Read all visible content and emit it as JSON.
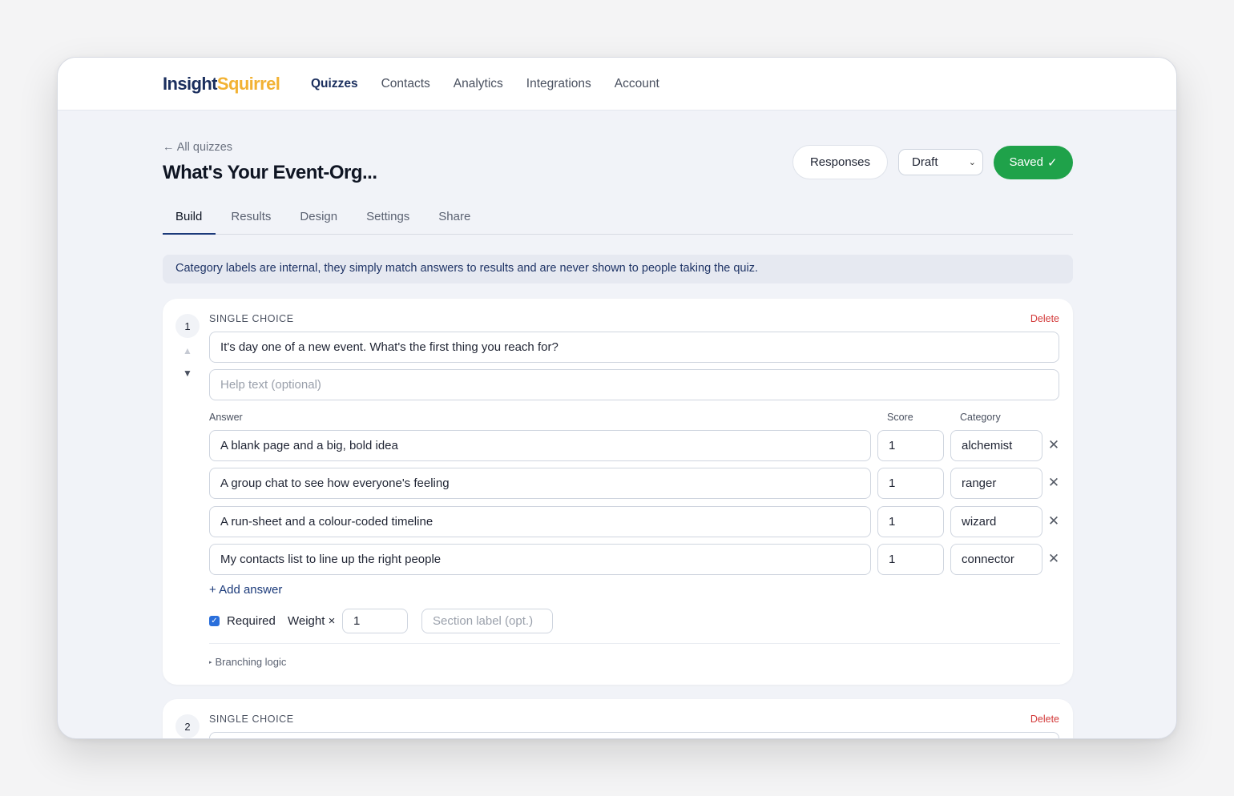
{
  "brand": {
    "part1": "Insight",
    "part2": "Squirrel"
  },
  "nav": {
    "items": [
      "Quizzes",
      "Contacts",
      "Analytics",
      "Integrations",
      "Account"
    ],
    "active": "Quizzes"
  },
  "header": {
    "back_label": "All quizzes",
    "title": "What's Your Event-Org...",
    "responses_label": "Responses",
    "status_value": "Draft",
    "saved_label": "Saved"
  },
  "tabs": [
    "Build",
    "Results",
    "Design",
    "Settings",
    "Share"
  ],
  "notice": "Category labels are internal, they simply match answers to results and are never shown to people taking the quiz.",
  "question1": {
    "number": "1",
    "type": "SINGLE CHOICE",
    "delete_label": "Delete",
    "text": "It's day one of a new event. What's the first thing you reach for?",
    "help_placeholder": "Help text (optional)",
    "headers": {
      "answer": "Answer",
      "score": "Score",
      "category": "Category"
    },
    "answers": [
      {
        "text": "A blank page and a big, bold idea",
        "score": "1",
        "category": "alchemist"
      },
      {
        "text": "A group chat to see how everyone's feeling",
        "score": "1",
        "category": "ranger"
      },
      {
        "text": "A run-sheet and a colour-coded timeline",
        "score": "1",
        "category": "wizard"
      },
      {
        "text": "My contacts list to line up the right people",
        "score": "1",
        "category": "connector"
      }
    ],
    "add_answer_label": "+ Add answer",
    "required_label": "Required",
    "required_checked": true,
    "weight_label": "Weight ×",
    "weight_value": "1",
    "section_placeholder": "Section label (opt.)",
    "branching_label": "Branching logic"
  },
  "question2": {
    "number": "2",
    "type": "SINGLE CHOICE",
    "delete_label": "Delete"
  },
  "colors": {
    "brand_navy": "#1b2f5e",
    "brand_yellow": "#f2b233",
    "saved_green": "#1fa24a",
    "delete_red": "#d33a3a"
  }
}
